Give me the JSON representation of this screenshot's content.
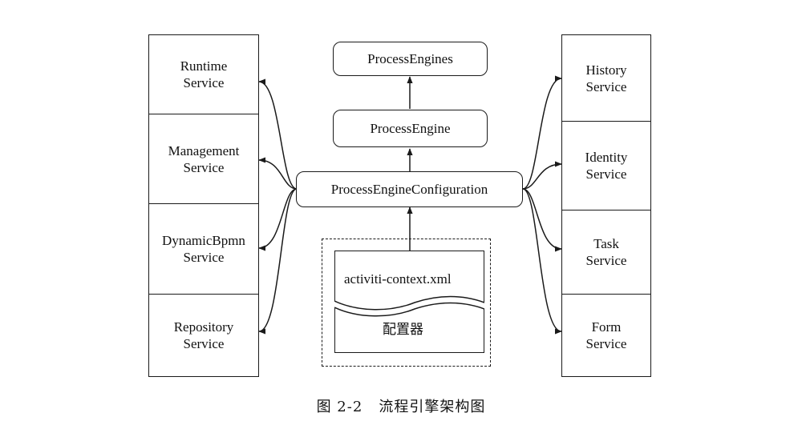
{
  "left_services": [
    {
      "label": "Runtime\nService"
    },
    {
      "label": "Management\nService"
    },
    {
      "label": "DynamicBpmn\nService"
    },
    {
      "label": "Repository\nService"
    }
  ],
  "right_services": [
    {
      "label": "History\nService"
    },
    {
      "label": "Identity\nService"
    },
    {
      "label": "Task\nService"
    },
    {
      "label": "Form\nService"
    }
  ],
  "center": {
    "process_engines": "ProcessEngines",
    "process_engine": "ProcessEngine",
    "configuration": "ProcessEngineConfiguration"
  },
  "configurator": {
    "file_label": "activiti-context.xml",
    "name": "配置器"
  },
  "caption": "图 2-2   流程引擎架构图"
}
